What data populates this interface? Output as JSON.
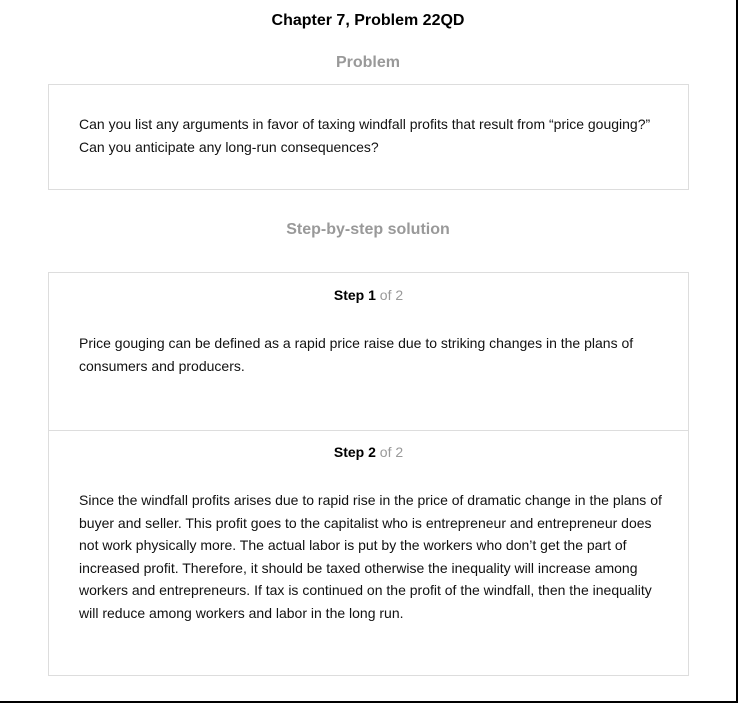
{
  "page": {
    "title": "Chapter 7, Problem 22QD"
  },
  "problem": {
    "heading": "Problem",
    "text": "Can you list any arguments in favor of taxing windfall profits that result from “price gouging?” Can you anticipate any long-run consequences?"
  },
  "solution": {
    "heading": "Step-by-step solution",
    "steps": [
      {
        "label": "Step",
        "number": "1",
        "of_text": "of 2",
        "text": "Price gouging can be defined as a rapid price raise due to striking changes in the plans of consumers and producers."
      },
      {
        "label": "Step",
        "number": "2",
        "of_text": "of 2",
        "text": "Since the windfall profits arises due to rapid rise in the price of dramatic change in the plans of buyer and seller. This profit goes to the capitalist who is entrepreneur and entrepreneur does not work physically more. The actual labor is put by the workers who don’t get the part of increased profit. Therefore, it should be taxed otherwise the inequality will increase among workers and entrepreneurs. If tax is continued on the profit of the windfall, then the inequality will reduce among workers and labor in the long run."
      }
    ]
  }
}
